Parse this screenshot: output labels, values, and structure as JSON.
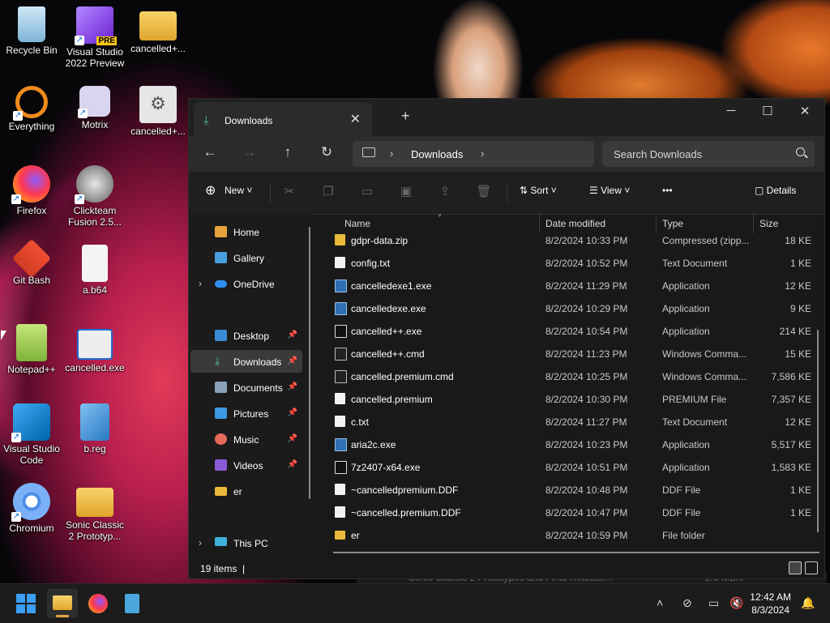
{
  "desktop": {
    "icons": [
      {
        "label": "Recycle Bin",
        "icon": "recycle-bin-icon"
      },
      {
        "label": "Visual Studio 2022 Preview",
        "label1": "Visual Studio",
        "label2": "2022 Preview",
        "icon": "visual-studio-icon",
        "badge": "PRE"
      },
      {
        "label": "cancelled+...",
        "icon": "folder-icon"
      },
      {
        "label": "Everything",
        "icon": "everything-icon"
      },
      {
        "label": "Motrix",
        "icon": "motrix-icon"
      },
      {
        "label": "cancelled+...",
        "icon": "settings-file-icon"
      },
      {
        "label": "Firefox",
        "icon": "firefox-icon"
      },
      {
        "label": "Clickteam Fusion 2.5...",
        "label1": "Clickteam",
        "label2": "Fusion 2.5...",
        "icon": "clickteam-icon"
      },
      {
        "label": "Git Bash",
        "icon": "git-bash-icon"
      },
      {
        "label": "a.b64",
        "icon": "file-icon"
      },
      {
        "label": "Notepad++",
        "icon": "notepadpp-icon"
      },
      {
        "label": "cancelled.exe",
        "icon": "exe-icon"
      },
      {
        "label": "Visual Studio Code",
        "label1": "Visual Studio",
        "label2": "Code",
        "icon": "vscode-icon"
      },
      {
        "label": "b.reg",
        "icon": "registry-icon"
      },
      {
        "label": "Chromium",
        "icon": "chromium-icon"
      },
      {
        "label": "Sonic Classic 2 Prototyp...",
        "label1": "Sonic Classic",
        "label2": "2 Prototyp...",
        "icon": "folder-icon"
      }
    ]
  },
  "explorer": {
    "tab_title": "Downloads",
    "window_buttons": {
      "minimize": "─",
      "maximize": "☐",
      "close": "✕"
    },
    "breadcrumb": "Downloads",
    "search_placeholder": "Search Downloads",
    "toolbar": {
      "new": "New",
      "sort": "Sort",
      "view": "View",
      "more": "•••",
      "details": "Details"
    },
    "sidebar": [
      {
        "label": "Home",
        "icon": "home-icon"
      },
      {
        "label": "Gallery",
        "icon": "gallery-icon"
      },
      {
        "label": "OneDrive",
        "icon": "onedrive-icon"
      },
      {
        "label": "Desktop",
        "icon": "desktop-folder-icon"
      },
      {
        "label": "Downloads",
        "icon": "downloads-icon"
      },
      {
        "label": "Documents",
        "icon": "documents-icon"
      },
      {
        "label": "Pictures",
        "icon": "pictures-icon"
      },
      {
        "label": "Music",
        "icon": "music-icon"
      },
      {
        "label": "Videos",
        "icon": "videos-icon"
      },
      {
        "label": "er",
        "icon": "folder-icon"
      },
      {
        "label": "This PC",
        "icon": "this-pc-icon"
      }
    ],
    "columns": {
      "name": "Name",
      "date": "Date modified",
      "type": "Type",
      "size": "Size"
    },
    "files": [
      {
        "name": "gdpr-data.zip",
        "date": "8/2/2024 10:33 PM",
        "type": "Compressed (zipp...",
        "size": "18 KE",
        "kind": "zip"
      },
      {
        "name": "config.txt",
        "date": "8/2/2024 10:52 PM",
        "type": "Text Document",
        "size": "1 KE",
        "kind": "doc"
      },
      {
        "name": "cancelledexe1.exe",
        "date": "8/2/2024 11:29 PM",
        "type": "Application",
        "size": "12 KE",
        "kind": "app"
      },
      {
        "name": "cancelledexe.exe",
        "date": "8/2/2024 10:29 PM",
        "type": "Application",
        "size": "9 KE",
        "kind": "app"
      },
      {
        "name": "cancelled++.exe",
        "date": "8/2/2024 10:54 PM",
        "type": "Application",
        "size": "214 KE",
        "kind": "7z"
      },
      {
        "name": "cancelled++.cmd",
        "date": "8/2/2024 11:23 PM",
        "type": "Windows Comma...",
        "size": "15 KE",
        "kind": "cmd"
      },
      {
        "name": "cancelled.premium.cmd",
        "date": "8/2/2024 10:25 PM",
        "type": "Windows Comma...",
        "size": "7,586 KE",
        "kind": "cmd"
      },
      {
        "name": "cancelled.premium",
        "date": "8/2/2024 10:30 PM",
        "type": "PREMIUM File",
        "size": "7,357 KE",
        "kind": "doc"
      },
      {
        "name": "c.txt",
        "date": "8/2/2024 11:27 PM",
        "type": "Text Document",
        "size": "12 KE",
        "kind": "doc"
      },
      {
        "name": "aria2c.exe",
        "date": "8/2/2024 10:23 PM",
        "type": "Application",
        "size": "5,517 KE",
        "kind": "app"
      },
      {
        "name": "7z2407-x64.exe",
        "date": "8/2/2024 10:51 PM",
        "type": "Application",
        "size": "1,583 KE",
        "kind": "7z"
      },
      {
        "name": "~cancelledpremium.DDF",
        "date": "8/2/2024 10:48 PM",
        "type": "DDF File",
        "size": "1 KE",
        "kind": "doc"
      },
      {
        "name": "~cancelled.premium.DDF",
        "date": "8/2/2024 10:47 PM",
        "type": "DDF File",
        "size": "1 KE",
        "kind": "doc"
      },
      {
        "name": "er",
        "date": "8/2/2024 10:59 PM",
        "type": "File folder",
        "size": "",
        "kind": "folder"
      }
    ],
    "status": "19 items"
  },
  "background_window_text": "Sonic Classic 2 Prototypes and Final Release...",
  "background_window_rate": "2.8 MB/s",
  "taskbar": {
    "time": "12:42 AM",
    "date": "8/3/2024"
  },
  "colors": {
    "accent": "#4cc2a1",
    "selection": "#3a3a3a",
    "window_bg": "#191919"
  }
}
